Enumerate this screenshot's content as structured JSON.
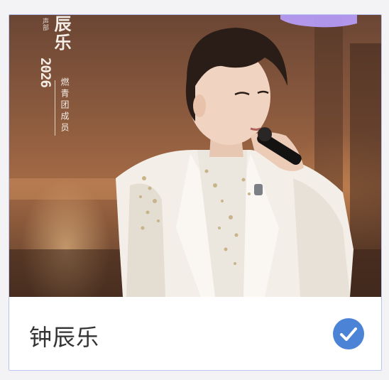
{
  "card": {
    "photo": {
      "overlay_name": "辰乐",
      "overlay_year": "2026",
      "overlay_role": "燃青团成员",
      "overlay_small": "声部"
    },
    "name": "钟辰乐",
    "selected": true
  },
  "colors": {
    "card_border": "#b9c4f2",
    "check_fill": "#4b84d6",
    "name_text": "#333333"
  },
  "icons": {
    "selected": "check-circle-icon"
  }
}
